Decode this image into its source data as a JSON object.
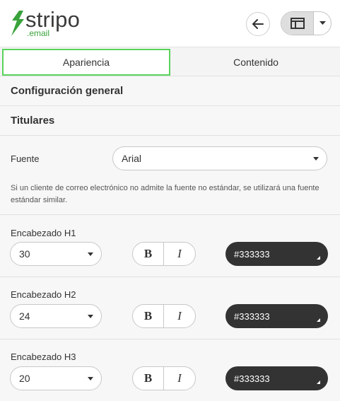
{
  "logo": {
    "word": "stripo",
    "sub": ".email"
  },
  "header": {
    "back_icon": "arrow-left-icon",
    "layout_icon": "layout-panel-icon",
    "dropdown_icon": "chevron-down-icon"
  },
  "tabs": [
    {
      "label": "Apariencia",
      "active": true
    },
    {
      "label": "Contenido",
      "active": false
    }
  ],
  "sections": {
    "general": "Configuración general",
    "headings": "Titulares"
  },
  "font": {
    "label": "Fuente",
    "value": "Arial",
    "note": "Si un cliente de correo electrónico no admite la fuente no estándar, se utilizará una fuente estándar similar."
  },
  "headings": [
    {
      "label": "Encabezado H1",
      "size": "30",
      "bold": "B",
      "italic": "I",
      "color": "#333333"
    },
    {
      "label": "Encabezado H2",
      "size": "24",
      "bold": "B",
      "italic": "I",
      "color": "#333333"
    },
    {
      "label": "Encabezado H3",
      "size": "20",
      "bold": "B",
      "italic": "I",
      "color": "#333333"
    }
  ],
  "colors": {
    "accent": "#5ad35c",
    "brand": "#39a23b",
    "swatch": "#333333"
  }
}
